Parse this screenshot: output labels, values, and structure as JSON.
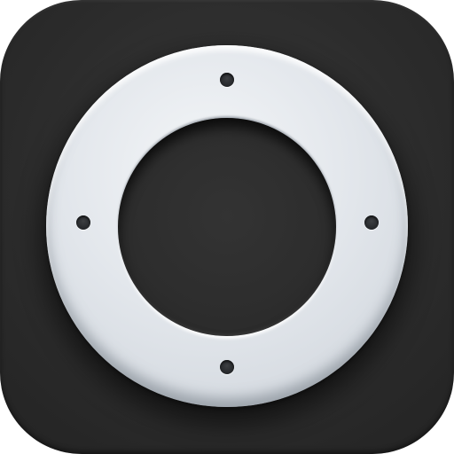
{
  "icon": {
    "semantic": "apple-tv-remote-app-icon",
    "colors": {
      "tile_background": "#2c2c2c",
      "ring": "#e3e7ec",
      "center_well": "#2d2d2d",
      "indicator_dots": "#2a2c2f"
    }
  }
}
